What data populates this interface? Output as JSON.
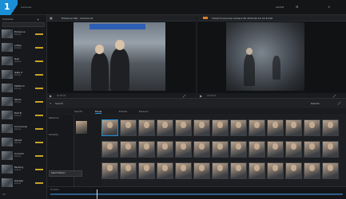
{
  "app": {
    "corner_label": "1"
  },
  "topbar": {
    "left_text": "Cameras",
    "right_text": "ADMIN"
  },
  "sidebar": {
    "header": "Cameras",
    "add_icon": "plus-icon",
    "cameras": [
      {
        "name": "Entrance",
        "sub": "Online"
      },
      {
        "name": "Lobby",
        "sub": "Online"
      },
      {
        "name": "Hall",
        "sub": "Online"
      },
      {
        "name": "Gate 2",
        "sub": "Online"
      },
      {
        "name": "Platform",
        "sub": "Online"
      },
      {
        "name": "Stairs",
        "sub": "Online"
      },
      {
        "name": "Exit B",
        "sub": "Online"
      },
      {
        "name": "Concourse",
        "sub": "Online"
      },
      {
        "name": "Street",
        "sub": "Online"
      },
      {
        "name": "Corridor",
        "sub": "Online"
      },
      {
        "name": "Parking",
        "sub": "Online"
      },
      {
        "name": "Garage",
        "sub": "Online"
      }
    ],
    "footer": "12"
  },
  "viewer_left": {
    "title": "Entrance Hall - Camera 01",
    "controls": "00:00:00"
  },
  "viewer_right": {
    "title": "Ticket Concourse Camera 06 2019-02-14 14:32:08",
    "controls": "00:00:00"
  },
  "midbar": {
    "label": "Search",
    "right_label": "Results"
  },
  "tabs": [
    {
      "label": "Search"
    },
    {
      "label": "Faces"
    },
    {
      "label": "Events"
    },
    {
      "label": "Persons"
    }
  ],
  "left_panel": {
    "label_top": "Reference",
    "label_mid": "Similarity"
  },
  "tooltip": {
    "text": "Search Person"
  },
  "timeline": {
    "label": "Timeline"
  },
  "colors": {
    "accent": "#1b8fd6",
    "recording": "#d9822b",
    "status_bar": "#c9a227"
  }
}
